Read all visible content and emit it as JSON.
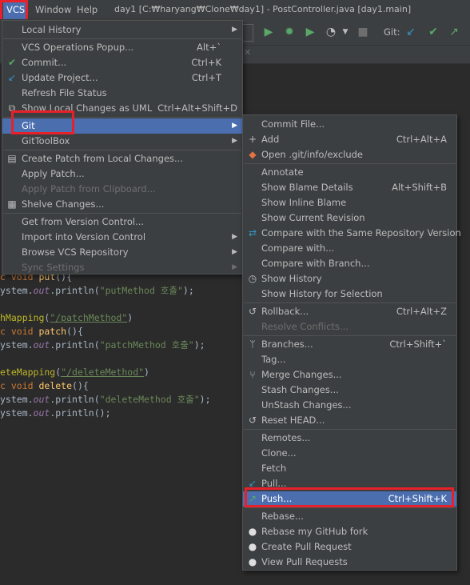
{
  "menubar": {
    "vcs": "VCS",
    "window": "Window",
    "help": "Help",
    "title": "day1 [C:₩haryang₩Clone₩day1] - PostController.java [day1.main]"
  },
  "toolbar": {
    "git_label": "Git:"
  },
  "code_lines": [
    "c void put(){",
    "ystem.out.println(\"putMethod 호출\");",
    "",
    "hMapping(\"/patchMethod\")",
    "c void patch(){",
    "ystem.out.println(\"patchMethod 호출\");",
    "",
    "eteMapping(\"/deleteMethod\")",
    "c void delete(){",
    "ystem.out.println(\"deleteMethod 호출\");",
    "ystem.out.println();"
  ],
  "code": {
    "l1_kw": "c void ",
    "l1_fn": "put",
    "l1_rest": "(){",
    "l2_a": "ystem.",
    "l2_f": "out",
    "l2_b": ".println(",
    "l2_s": "\"putMethod 호출\"",
    "l2_c": ");",
    "l4_a": "hMapping",
    "l4_b": "(",
    "l4_s": "\"/patchMethod\"",
    "l4_c": ")",
    "l5_kw": "c void ",
    "l5_fn": "patch",
    "l5_rest": "(){",
    "l6_a": "ystem.",
    "l6_f": "out",
    "l6_b": ".println(",
    "l6_s": "\"patchMethod 호출\"",
    "l6_c": ");",
    "l8_a": "eteMapping",
    "l8_b": "(",
    "l8_s": "\"/deleteMethod\"",
    "l8_c": ")",
    "l9_kw": "c void ",
    "l9_fn": "delete",
    "l9_rest": "(){",
    "l10_a": "ystem.",
    "l10_f": "out",
    "l10_b": ".println(",
    "l10_s": "\"deleteMethod 호출\"",
    "l10_c": ");",
    "l11_a": "ystem.",
    "l11_f": "out",
    "l11_b": ".println();"
  },
  "vcs_menu": {
    "local_history": "Local History",
    "vcs_operations_popup": "VCS Operations Popup...",
    "vcs_operations_popup_sc": "Alt+`",
    "commit": "Commit...",
    "commit_sc": "Ctrl+K",
    "update_project": "Update Project...",
    "update_project_sc": "Ctrl+T",
    "refresh_file_status": "Refresh File Status",
    "show_local_changes_uml": "Show Local Changes as UML",
    "show_local_changes_uml_sc": "Ctrl+Alt+Shift+D",
    "git": "Git",
    "gittoolbox": "GitToolBox",
    "create_patch": "Create Patch from Local Changes...",
    "apply_patch": "Apply Patch...",
    "apply_patch_clipboard": "Apply Patch from Clipboard...",
    "shelve_changes": "Shelve Changes...",
    "get_from_vc": "Get from Version Control...",
    "import_into_vc": "Import into Version Control",
    "browse_vcs_repo": "Browse VCS Repository",
    "sync_settings": "Sync Settings"
  },
  "git_menu": {
    "commit_file": "Commit File...",
    "add": "Add",
    "add_sc": "Ctrl+Alt+A",
    "open_exclude": "Open .git/info/exclude",
    "annotate": "Annotate",
    "show_blame_details": "Show Blame Details",
    "show_blame_details_sc": "Alt+Shift+B",
    "show_inline_blame": "Show Inline Blame",
    "show_current_revision": "Show Current Revision",
    "compare_same_repo": "Compare with the Same Repository Version",
    "compare_with": "Compare with...",
    "compare_with_branch": "Compare with Branch...",
    "show_history": "Show History",
    "show_history_selection": "Show History for Selection",
    "rollback": "Rollback...",
    "rollback_sc": "Ctrl+Alt+Z",
    "resolve_conflicts": "Resolve Conflicts...",
    "branches": "Branches...",
    "branches_sc": "Ctrl+Shift+`",
    "tag": "Tag...",
    "merge_changes": "Merge Changes...",
    "stash_changes": "Stash Changes...",
    "unstash_changes": "UnStash Changes...",
    "reset_head": "Reset HEAD...",
    "remotes": "Remotes...",
    "clone": "Clone...",
    "fetch": "Fetch",
    "pull": "Pull...",
    "push": "Push...",
    "push_sc": "Ctrl+Shift+K",
    "rebase": "Rebase...",
    "rebase_github_fork": "Rebase my GitHub fork",
    "create_pull_request": "Create Pull Request",
    "view_pull_requests": "View Pull Requests"
  },
  "colors": {
    "selection": "#4b6eaf",
    "highlight_box": "#e8202a",
    "menu_bg": "#3c3f41"
  }
}
